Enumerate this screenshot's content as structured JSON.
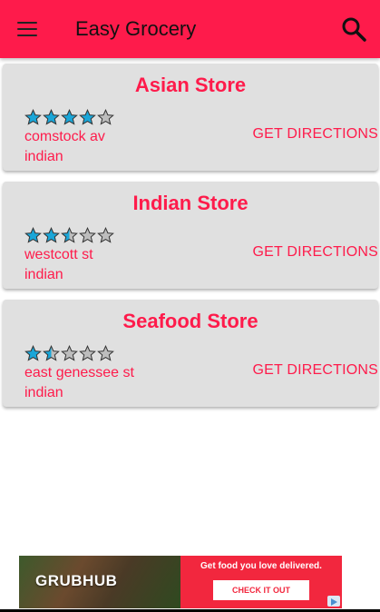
{
  "appbar": {
    "title": "Easy Grocery",
    "background": "#fe1b4b",
    "menu_icon": "hamburger-menu-icon",
    "search_icon": "search-icon"
  },
  "stores": [
    {
      "name": "Asian Store",
      "rating": 4,
      "line1": "comstock av",
      "line2": "indian",
      "action": "GET DIRECTIONS"
    },
    {
      "name": "Indian Store",
      "rating": 2.5,
      "line1": "westcott st",
      "line2": "indian",
      "action": "GET DIRECTIONS"
    },
    {
      "name": "Seafood Store",
      "rating": 1.5,
      "line1": "east genessee st",
      "line2": "indian",
      "action": "GET DIRECTIONS"
    }
  ],
  "rating_max": 5,
  "colors": {
    "accent": "#fe1b4b",
    "star_fill": "#1aa6d8",
    "star_empty": "#bdbdbd",
    "card": "#e0e0e0"
  },
  "ad": {
    "brand": "GRUBHUB",
    "tagline": "Get food you love delivered.",
    "cta": "CHECK IT OUT",
    "choices_icon": "ad-choices-icon"
  }
}
